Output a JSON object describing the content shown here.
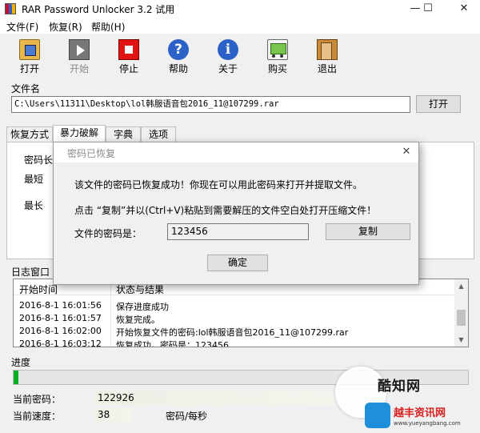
{
  "window": {
    "title": "RAR Password Unlocker 3.2 试用",
    "min_glyph": "—",
    "max_glyph": "☐",
    "close_glyph": "✕"
  },
  "menu": [
    "文件(F)",
    "恢复(R)",
    "帮助(H)"
  ],
  "toolbar": [
    {
      "label": "打开",
      "icon": "open-icon",
      "enabled": true
    },
    {
      "label": "开始",
      "icon": "play-icon",
      "enabled": false
    },
    {
      "label": "停止",
      "icon": "stop-icon",
      "enabled": true
    },
    {
      "label": "帮助",
      "icon": "help-icon",
      "enabled": true
    },
    {
      "label": "关于",
      "icon": "info-icon",
      "enabled": true
    },
    {
      "label": "购买",
      "icon": "cart-icon",
      "enabled": true
    },
    {
      "label": "退出",
      "icon": "exit-door-icon",
      "enabled": true
    }
  ],
  "icon_glyphs": {
    "help": "?",
    "about": "i"
  },
  "file": {
    "label": "文件名",
    "path": "C:\\Users\\11311\\Desktop\\lol韩服语音包2016_11@107299.rar",
    "open_button": "打开"
  },
  "tabs": [
    {
      "label": "恢复方式",
      "active": false
    },
    {
      "label": "暴力破解",
      "active": true
    },
    {
      "label": "字典",
      "active": false
    },
    {
      "label": "选项",
      "active": false
    }
  ],
  "brute_panel": {
    "length_label": "密码长度",
    "min_label": "最短",
    "max_label": "最长"
  },
  "log": {
    "label": "日志窗口",
    "col_time": "开始时间",
    "col_status": "状态与结果",
    "rows": [
      {
        "time": "2016-8-1  16:01:56",
        "msg": "保存进度成功"
      },
      {
        "time": "2016-8-1  16:01:57",
        "msg": "恢复完成。"
      },
      {
        "time": "2016-8-1  16:02:00",
        "msg": "开始恢复文件的密码:lol韩服语音包2016_11@107299.rar"
      },
      {
        "time": "2016-8-1  16:03:12",
        "msg": "恢复成功，密码是：123456"
      }
    ],
    "scroll_up": "▲",
    "scroll_down": "▼"
  },
  "progress": {
    "label": "进度",
    "value": 0.01
  },
  "status": {
    "current_password_label": "当前密码：",
    "current_password": "122926",
    "current_speed_label": "当前速度：",
    "current_speed": "38",
    "speed_unit": "密码/每秒"
  },
  "dialog": {
    "title": "密码已恢复",
    "close_glyph": "✕",
    "message1": "该文件的密码已恢复成功！你现在可以用此密码来打开并提取文件。",
    "message2": "点击 “复制”并以(Ctrl+V)粘贴到需要解压的文件空白处打开压缩文件！",
    "password_label": "文件的密码是：",
    "password_value": "123456",
    "copy_button": "复制",
    "ok_button": "确定"
  },
  "watermark": {
    "brand": "酷知网",
    "site_name": "越丰资讯网",
    "site_url": "www.yueyangbang.com"
  },
  "colors": {
    "progress_green": "#06b025",
    "watermark_red": "#d81e1e",
    "icon_blue": "#2c62c8"
  }
}
